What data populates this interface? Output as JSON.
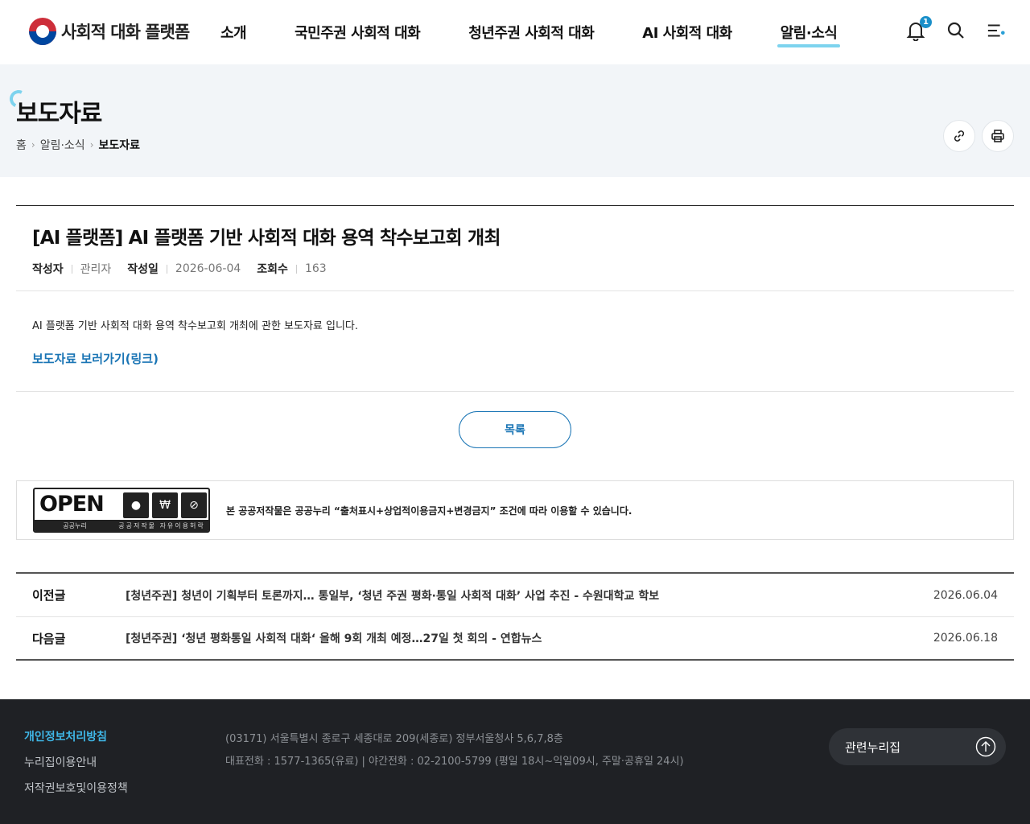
{
  "header": {
    "logo_text": "사회적 대화 플랫폼",
    "nav": [
      "소개",
      "국민주권 사회적 대화",
      "청년주권 사회적 대화",
      "AI 사회적 대화",
      "알림·소식"
    ],
    "notification_count": "1",
    "icons": [
      "bell-icon",
      "search-icon",
      "menu-icon"
    ]
  },
  "band": {
    "page_title": "보도자료",
    "breadcrumb": [
      "홈",
      "알림·소식",
      "보도자료"
    ],
    "buttons": [
      "link-icon",
      "print-icon"
    ]
  },
  "article": {
    "title": "[AI 플랫폼] AI 플랫폼 기반 사회적 대화 용역 착수보고회 개최",
    "meta": {
      "author_label": "작성자",
      "author": "관리자",
      "date_label": "작성일",
      "date": "2026-06-04",
      "views_label": "조회수",
      "views": "163"
    },
    "body": "AI 플랫폼 기반 사회적 대화 용역 착수보고회 개최에 관한 보도자료 입니다.",
    "link_text": "보도자료 보러가기(링크)"
  },
  "list_button": "목록",
  "kogl": {
    "open_text": "OPEN",
    "strip_left": "공공누리",
    "strip_right": "공공저작물 자유이용허락",
    "icon_labels": [
      "출처표시",
      "상업용금지",
      "변경금지"
    ],
    "notice": "본 공공저작물은 공공누리 “출처표시+상업적이용금지+변경금지” 조건에 따라 이용할 수 있습니다."
  },
  "prevnext": [
    {
      "label": "이전글",
      "title": "[청년주권] 청년이 기획부터 토론까지… 통일부, ‘청년 주권 평화·통일 사회적 대화’ 사업 추진 - 수원대학교 학보",
      "date": "2026.06.04"
    },
    {
      "label": "다음글",
      "title": "[청년주권] ‘청년 평화통일 사회적 대화‘ 올해 9회 개최 예정…27일 첫 회의 - 연합뉴스",
      "date": "2026.06.18"
    }
  ],
  "footer": {
    "links": [
      "개인정보처리방침",
      "누리집이용안내",
      "저작권보호및이용정책"
    ],
    "address": "(03171) 서울특별시 종로구 세종대로 209(세종로) 정부서울청사 5,6,7,8층",
    "phone": "대표전화 : 1577-1365(유료)  |  야간전화 : 02-2100-5799 (평일 18시~익일09시, 주말·공휴일 24시)",
    "related_label": "관련누리집"
  }
}
